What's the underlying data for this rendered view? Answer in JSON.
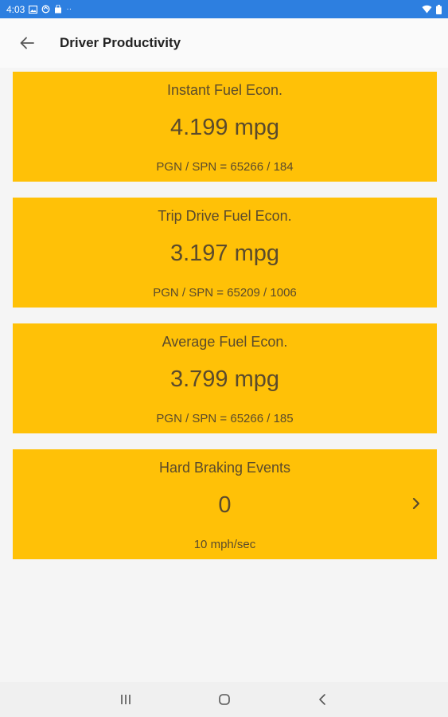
{
  "status_bar": {
    "time": "4:03",
    "left_icons": [
      "image-icon",
      "sync-icon",
      "shopping-bag-icon",
      "more-dots-icon"
    ],
    "right_icons": [
      "wifi-icon",
      "battery-icon"
    ]
  },
  "app_bar": {
    "title": "Driver Productivity",
    "back_icon": "arrow-left-icon"
  },
  "cards": [
    {
      "title": "Instant Fuel Econ.",
      "value": "4.199 mpg",
      "footer": "PGN / SPN = 65266 / 184"
    },
    {
      "title": "Trip Drive Fuel Econ.",
      "value": "3.197 mpg",
      "footer": "PGN / SPN = 65209 / 1006"
    },
    {
      "title": "Average Fuel Econ.",
      "value": "3.799 mpg",
      "footer": "PGN / SPN = 65266 / 185"
    },
    {
      "title": "Hard Braking Events",
      "value": "0",
      "footer": "10 mph/sec",
      "chevron_icon": "chevron-right-icon"
    }
  ],
  "colors": {
    "status_bar": "#2d7fe0",
    "card_background": "#ffc107",
    "card_text": "#5b4b2c",
    "background": "#f5f5f5"
  },
  "nav_bar": {
    "buttons": [
      "recent-apps-icon",
      "home-icon",
      "back-icon"
    ]
  }
}
